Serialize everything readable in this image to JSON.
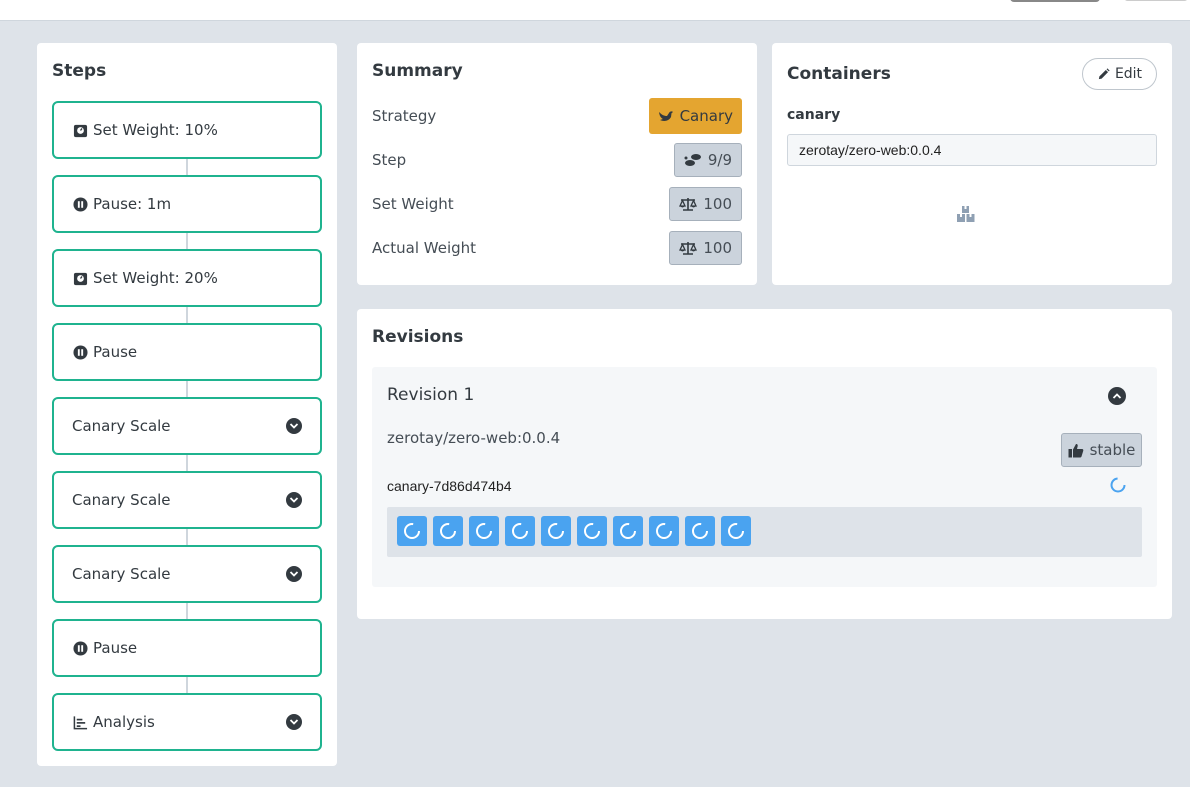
{
  "steps": {
    "title": "Steps",
    "items": [
      {
        "label": "Set Weight: 10%",
        "icon": "weight-icon",
        "expandable": false
      },
      {
        "label": "Pause: 1m",
        "icon": "pause-icon",
        "expandable": false
      },
      {
        "label": "Set Weight: 20%",
        "icon": "weight-icon",
        "expandable": false
      },
      {
        "label": "Pause",
        "icon": "pause-icon",
        "expandable": false
      },
      {
        "label": "Canary Scale",
        "icon": "",
        "expandable": true
      },
      {
        "label": "Canary Scale",
        "icon": "",
        "expandable": true
      },
      {
        "label": "Canary Scale",
        "icon": "",
        "expandable": true
      },
      {
        "label": "Pause",
        "icon": "pause-icon",
        "expandable": false
      },
      {
        "label": "Analysis",
        "icon": "chart-icon",
        "expandable": true
      }
    ]
  },
  "summary": {
    "title": "Summary",
    "rows": [
      {
        "label": "Strategy",
        "value": "Canary",
        "icon": "bird-icon"
      },
      {
        "label": "Step",
        "value": "9/9",
        "icon": "shoe-prints-icon"
      },
      {
        "label": "Set Weight",
        "value": "100",
        "icon": "balance-scale-icon"
      },
      {
        "label": "Actual Weight",
        "value": "100",
        "icon": "balance-scale-icon"
      }
    ]
  },
  "containers": {
    "title": "Containers",
    "edit_label": "Edit",
    "container_name": "canary",
    "image": "zerotay/zero-web:0.0.4",
    "icon": "boxes-icon"
  },
  "revisions": {
    "title": "Revisions",
    "revision": {
      "title": "Revision 1",
      "image": "zerotay/zero-web:0.0.4",
      "badge": "stable",
      "replicaset": "canary-7d86d474b4",
      "pod_count": 10
    }
  },
  "colors": {
    "step_border": "#1fb38f",
    "canary_badge": "#e4a530",
    "pod_blue": "#4aa3f0",
    "page_bg": "#dee3e9"
  }
}
